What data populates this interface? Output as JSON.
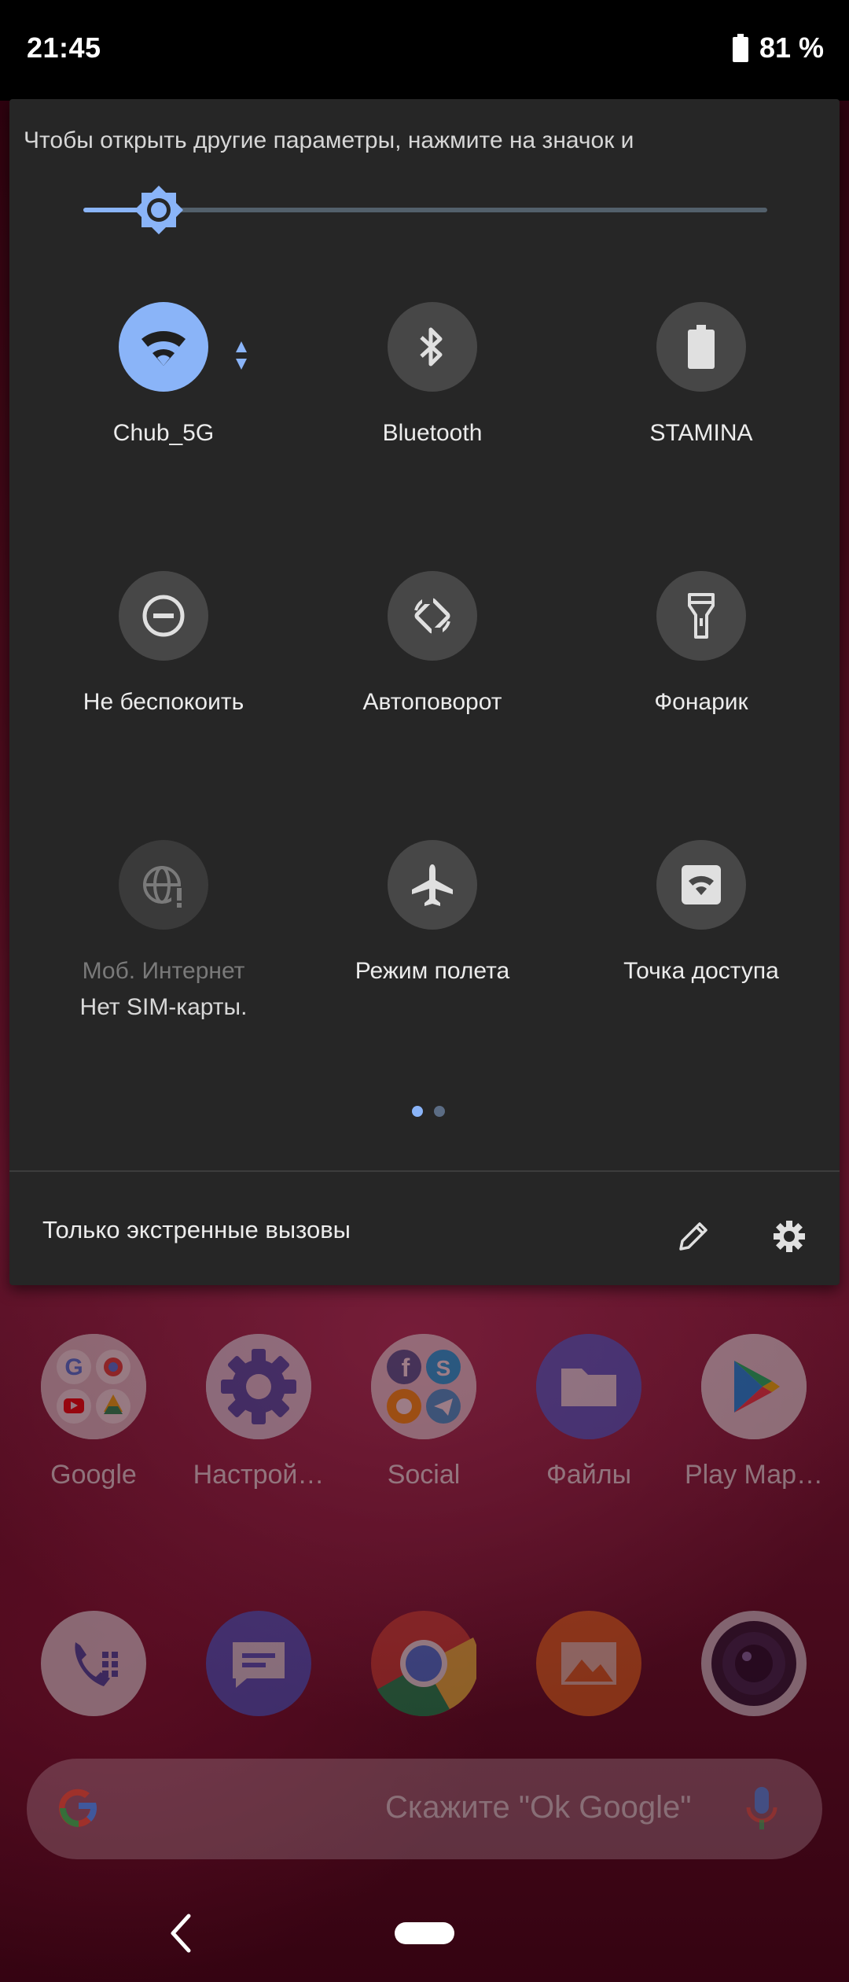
{
  "status_bar": {
    "time": "21:45",
    "battery": "81 %"
  },
  "quick_settings": {
    "hint": "Чтобы открыть другие параметры, нажмите на значок и",
    "brightness_level": 0.11,
    "tiles": [
      {
        "label": "Chub_5G",
        "icon": "wifi-icon",
        "state": "on"
      },
      {
        "label": "Bluetooth",
        "icon": "bluetooth-icon",
        "state": "off"
      },
      {
        "label": "STAMINA",
        "icon": "battery-icon",
        "state": "off"
      },
      {
        "label": "Не беспокоить",
        "icon": "do-not-disturb-icon",
        "state": "off"
      },
      {
        "label": "Автоповорот",
        "icon": "auto-rotate-icon",
        "state": "off"
      },
      {
        "label": "Фонарик",
        "icon": "flashlight-icon",
        "state": "off"
      },
      {
        "label": "Моб. Интернет",
        "sublabel": "Нет SIM-карты.",
        "icon": "mobile-data-icon",
        "state": "unavailable"
      },
      {
        "label": "Режим полета",
        "icon": "airplane-icon",
        "state": "off"
      },
      {
        "label": "Точка доступа",
        "icon": "hotspot-icon",
        "state": "off"
      }
    ],
    "pages": 2,
    "current_page": 1,
    "footer_text": "Только экстренные вызовы",
    "colors": {
      "accent": "#8ab4f8",
      "panel": "#262626",
      "tile": "#474747"
    }
  },
  "home": {
    "apps_row1": [
      {
        "label": "Google",
        "icon": "google-folder-icon"
      },
      {
        "label": "Настрой…",
        "icon": "settings-app-icon"
      },
      {
        "label": "Social",
        "icon": "social-folder-icon"
      },
      {
        "label": "Файлы",
        "icon": "files-icon"
      },
      {
        "label": "Play Мар…",
        "icon": "play-store-icon"
      }
    ],
    "dock": [
      {
        "icon": "phone-icon"
      },
      {
        "icon": "messages-icon"
      },
      {
        "icon": "chrome-icon"
      },
      {
        "icon": "gallery-icon"
      },
      {
        "icon": "camera-icon"
      }
    ],
    "search_placeholder": "Скажите \"Ok Google\""
  }
}
